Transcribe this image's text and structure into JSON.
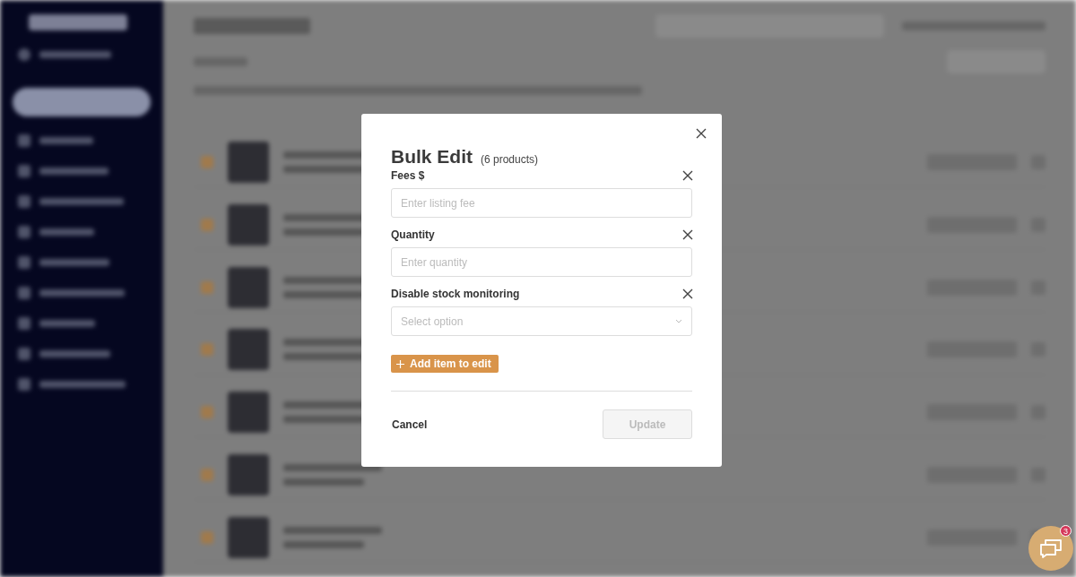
{
  "dialog": {
    "title": "Bulk Edit",
    "subtitle": "(6 products)",
    "fields": [
      {
        "kind": "text",
        "label": "Fees $",
        "placeholder": "Enter listing fee"
      },
      {
        "kind": "text",
        "label": "Quantity",
        "placeholder": "Enter quantity"
      },
      {
        "kind": "select",
        "label": "Disable stock monitoring",
        "placeholder": "Select option"
      }
    ],
    "add_button": "Add item to edit",
    "cancel_button": "Cancel",
    "update_button": {
      "label": "Update",
      "disabled": true
    }
  },
  "chat": {
    "badge": "3"
  }
}
